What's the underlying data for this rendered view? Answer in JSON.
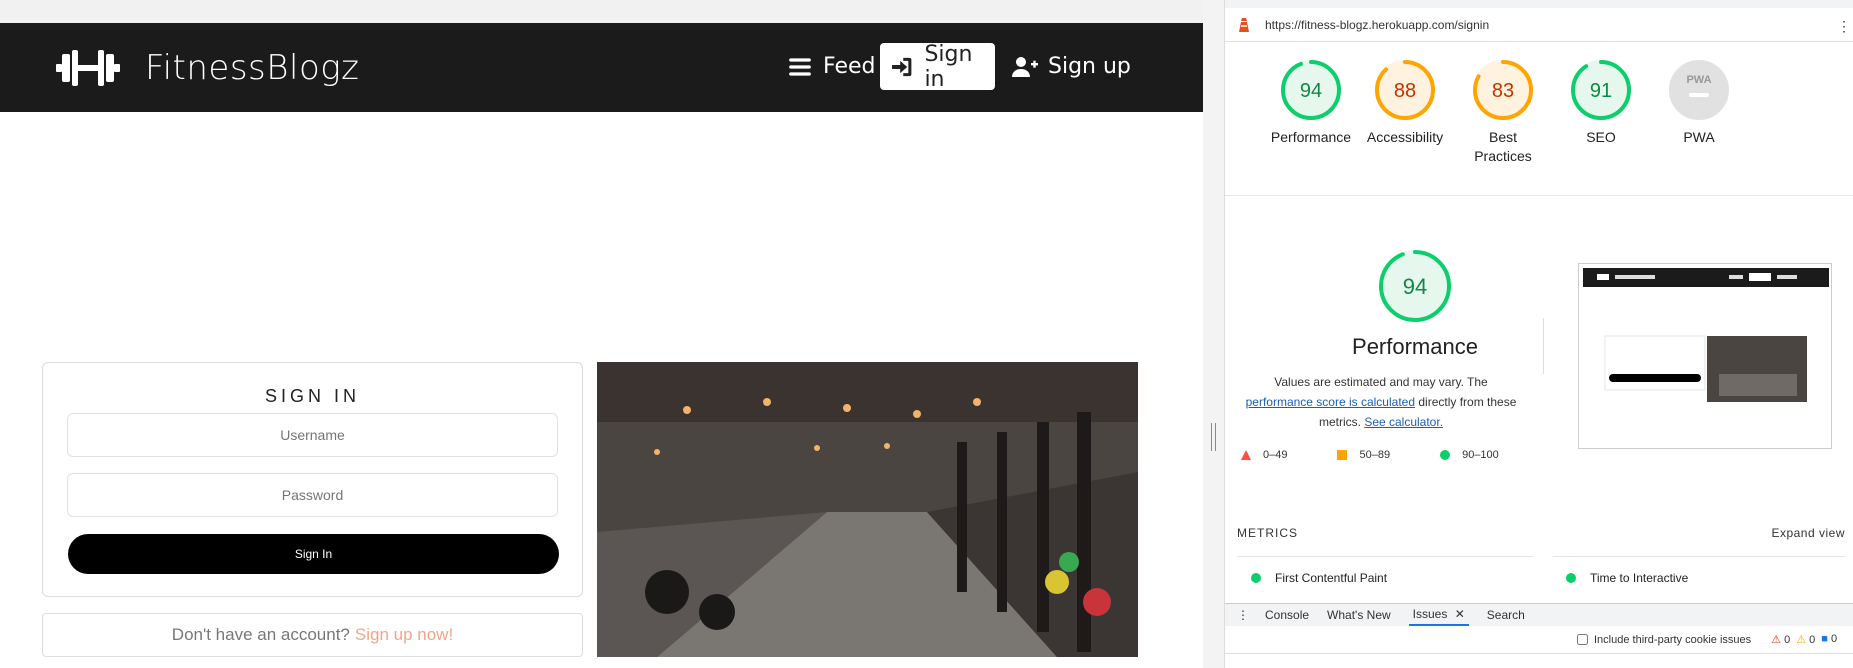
{
  "site": {
    "brand": "FitnessBlogz",
    "nav": {
      "feed": "Feed",
      "signin": "Sign in",
      "signup": "Sign up"
    },
    "signin_form": {
      "title": "SIGN IN",
      "username_placeholder": "Username",
      "password_placeholder": "Password",
      "button": "Sign In"
    },
    "signup_prompt": {
      "text": "Don't have an account?",
      "link": "Sign up now!"
    }
  },
  "devtools": {
    "url": "https://fitness-blogz.herokuapp.com/signin",
    "scores": [
      {
        "label": "Performance",
        "value": "94",
        "color": "#0cce6b"
      },
      {
        "label": "Accessibility",
        "value": "88",
        "color": "#ffa400"
      },
      {
        "label": "Best Practices",
        "value": "83",
        "color": "#ffa400"
      },
      {
        "label": "SEO",
        "value": "91",
        "color": "#0cce6b"
      },
      {
        "label": "PWA",
        "value": "PWA",
        "color": "#cccccc"
      }
    ],
    "performance": {
      "score": "94",
      "title": "Performance",
      "note_prefix": "Values are estimated and may vary. The",
      "note_link": "performance score is calculated",
      "note_mid": "directly from these metrics.",
      "calculator_link": "See calculator."
    },
    "legend": [
      {
        "range": "0–49",
        "color": "#ff4e42"
      },
      {
        "range": "50–89",
        "color": "#ffa400"
      },
      {
        "range": "90–100",
        "color": "#0cce6b"
      }
    ],
    "metrics": {
      "heading": "METRICS",
      "expand": "Expand view",
      "items": [
        "First Contentful Paint",
        "Time to Interactive"
      ]
    },
    "drawer": {
      "tabs": [
        "Console",
        "What's New",
        "Issues",
        "Search"
      ],
      "third_party_label": "Include third-party cookie issues",
      "counts": [
        "0",
        "0",
        "0"
      ]
    }
  }
}
